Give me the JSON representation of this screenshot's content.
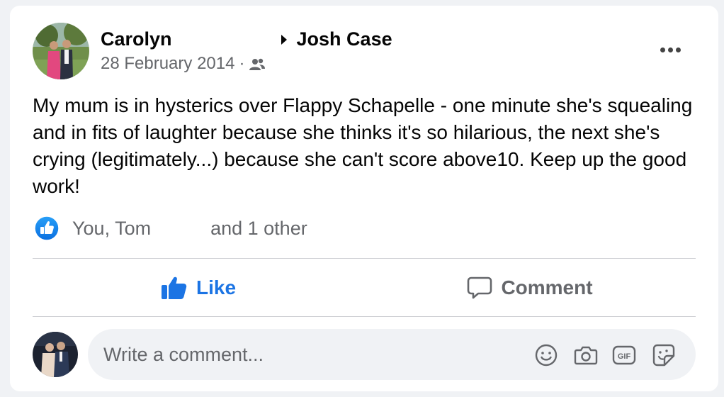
{
  "post": {
    "author": "Carolyn",
    "recipient": "Josh Case",
    "date": "28 February 2014",
    "separator": "·",
    "audience_icon": "friends-icon",
    "text": "My mum is in hysterics over Flappy Schapelle - one minute she's squealing and in fits of laughter because she thinks it's so hilarious, the next she's crying (legitimately...) because she can't score above10. Keep up the good work!"
  },
  "reactions": {
    "names": "You, Tom",
    "others": "and 1 other",
    "icon": "thumbs-up-badge"
  },
  "actions": {
    "like_label": "Like",
    "comment_label": "Comment"
  },
  "comment_box": {
    "placeholder": "Write a comment...",
    "icons": [
      "emoji-icon",
      "camera-icon",
      "gif-icon",
      "sticker-icon"
    ]
  },
  "colors": {
    "accent": "#1b74e4",
    "secondary_text": "#65676b",
    "background": "#f0f2f5",
    "card": "#ffffff"
  }
}
